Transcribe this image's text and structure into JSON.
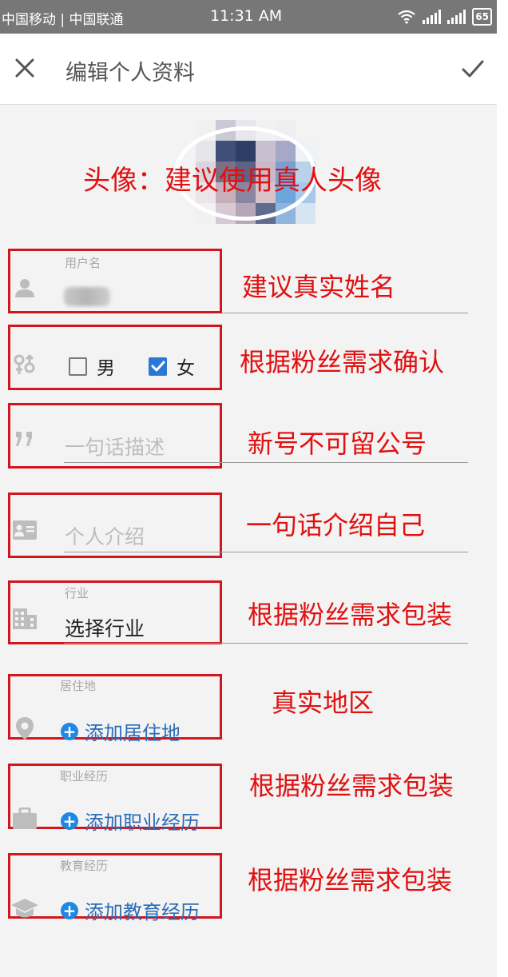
{
  "status_bar": {
    "carriers": "中国移动 | 中国联通",
    "time": "11:31 AM",
    "battery": "65"
  },
  "toolbar": {
    "title": "编辑个人资料",
    "close_icon": "close-icon",
    "confirm_icon": "check-icon"
  },
  "annotations": {
    "avatar": "头像：建议使用真人头像",
    "username": "建议真实姓名",
    "gender": "根据粉丝需求确认",
    "description": "新号不可留公号",
    "intro": "一句话介绍自己",
    "industry": "根据粉丝需求包装",
    "location": "真实地区",
    "career": "根据粉丝需求包装",
    "education": "根据粉丝需求包装"
  },
  "form": {
    "username": {
      "label": "用户名"
    },
    "gender": {
      "male": "男",
      "female": "女",
      "male_checked": false,
      "female_checked": true
    },
    "description": {
      "placeholder": "一句话描述"
    },
    "intro": {
      "placeholder": "个人介绍"
    },
    "industry": {
      "label": "行业",
      "value": "选择行业"
    },
    "location": {
      "label": "居住地",
      "add_label": "添加居住地"
    },
    "career": {
      "label": "职业经历",
      "add_label": "添加职业经历"
    },
    "education": {
      "label": "教育经历",
      "add_label": "添加教育经历"
    }
  },
  "colors": {
    "annotation": "#e01010",
    "link": "#2b6cb8",
    "checkbox_checked": "#2a78d6"
  }
}
